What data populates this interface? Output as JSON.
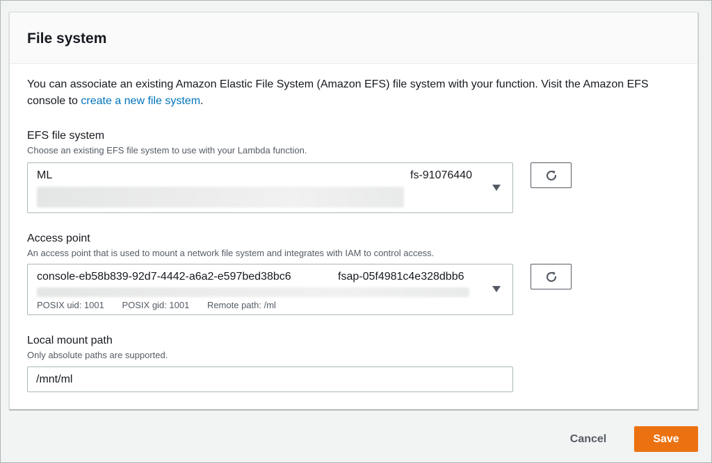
{
  "panel": {
    "title": "File system",
    "description_prefix": "You can associate an existing Amazon Elastic File System (Amazon EFS) file system with your function. Visit the Amazon EFS console to ",
    "description_link": "create a new file system",
    "description_suffix": "."
  },
  "efs": {
    "label": "EFS file system",
    "hint": "Choose an existing EFS file system to use with your Lambda function.",
    "selected_name": "ML",
    "selected_id": "fs-91076440",
    "refresh_icon": "refresh-icon"
  },
  "access_point": {
    "label": "Access point",
    "hint": "An access point that is used to mount a network file system and integrates with IAM to control access.",
    "selected_name": "console-eb58b839-92d7-4442-a6a2-e597bed38bc6",
    "selected_id": "fsap-05f4981c4e328dbb6",
    "posix_uid": "POSIX uid: 1001",
    "posix_gid": "POSIX gid: 1001",
    "remote_path": "Remote path: /ml",
    "refresh_icon": "refresh-icon"
  },
  "mount": {
    "label": "Local mount path",
    "hint": "Only absolute paths are supported.",
    "value": "/mnt/ml"
  },
  "footer": {
    "cancel_label": "Cancel",
    "save_label": "Save"
  },
  "colors": {
    "link": "#0073bb",
    "primary_button": "#ec7211",
    "background": "#f2f3f3"
  }
}
